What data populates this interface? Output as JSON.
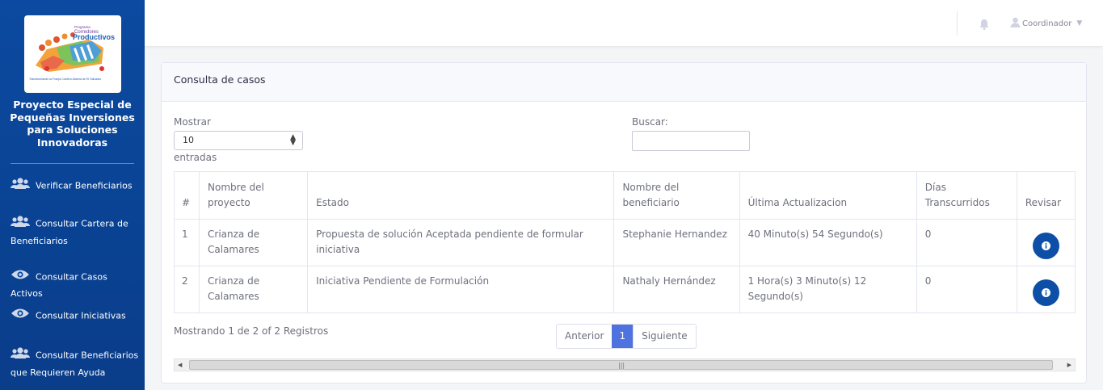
{
  "sidebar": {
    "logo": {
      "line1": "Programa",
      "line2": "Corredores",
      "line3": "Productivos",
      "tagline": "Transformando la Franja Costero-Marina de El Salvador"
    },
    "title": "Proyecto Especial de Pequeñas Inversiones para Soluciones Innovadoras",
    "items": [
      {
        "label": "Verificar Beneficiarios",
        "icon": "users-icon"
      },
      {
        "label": "Consultar Cartera de",
        "label2": "Beneficiarios",
        "icon": "users-icon"
      },
      {
        "label": "Consultar Casos Activos",
        "icon": "eye-icon"
      },
      {
        "label": "Consultar Iniciativas",
        "icon": "eye-icon"
      },
      {
        "label": "Consultar Beneficiarios",
        "label2": "que Requieren Ayuda",
        "icon": "users-icon"
      }
    ]
  },
  "topbar": {
    "user_name": "Coordinador",
    "caret": "▼"
  },
  "card": {
    "title": "Consulta de casos",
    "show_label": "Mostrar",
    "entries_label": "entradas",
    "page_size": "10",
    "search_label": "Buscar:",
    "search_value": ""
  },
  "table": {
    "headers": [
      "#",
      "Nombre del proyecto",
      "Estado",
      "Nombre del beneficiario",
      "Última Actualizacion",
      "Días Transcurridos",
      "Revisar"
    ],
    "header_lines": [
      [
        "#"
      ],
      [
        "Nombre del",
        "proyecto"
      ],
      [
        "Estado"
      ],
      [
        "Nombre del",
        "beneficiario"
      ],
      [
        "Última Actualizacion"
      ],
      [
        "Días",
        "Transcurridos"
      ],
      [
        "Revisar"
      ]
    ],
    "rows": [
      {
        "num": "1",
        "proyecto": "Crianza de Calamares",
        "estado": "Propuesta de solución Aceptada pendiente de formular iniciativa",
        "beneficiario": "Stephanie Hernandez",
        "actualizacion": "40 Minuto(s) 54 Segundo(s)",
        "dias": "0"
      },
      {
        "num": "2",
        "proyecto": "Crianza de Calamares",
        "estado": "Iniciativa Pendiente de Formulación",
        "beneficiario": "Nathaly Hernández",
        "actualizacion": "1 Hora(s) 3 Minuto(s) 12 Segundo(s)",
        "dias": "0"
      }
    ]
  },
  "footer": {
    "showing": "Mostrando 1 de 2 of 2 Registros",
    "prev": "Anterior",
    "current_page": "1",
    "next": "Siguiente"
  },
  "colors": {
    "sidebar": "#0b4aa0",
    "accent": "#4e73df",
    "button": "#0d4ea6"
  }
}
